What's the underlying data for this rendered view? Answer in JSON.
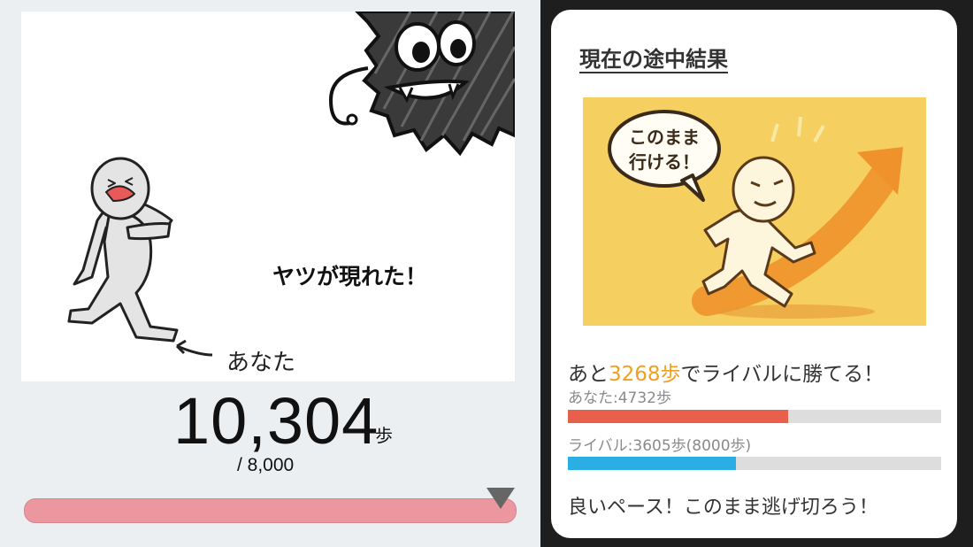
{
  "left": {
    "illustration": {
      "headline": "ヤツが現れた！",
      "you_label": "あなた"
    },
    "steps": {
      "value": "10,304",
      "unit": "歩",
      "goal": "/ 8,000"
    },
    "progress": {
      "fraction": 1.0,
      "color": "#ec97a0"
    }
  },
  "card": {
    "title": "現在の途中結果",
    "image_text": [
      "このまま",
      "行ける！"
    ],
    "status_prefix": "あと",
    "status_highlight": "3268歩",
    "status_suffix": "でライバルに勝てる！",
    "you": {
      "label": "あなた:4732歩",
      "fraction": 0.59,
      "color": "#e8604c"
    },
    "rival": {
      "label": "ライバル:3605歩(8000歩)",
      "fraction": 0.45,
      "color": "#2aaee4"
    },
    "message": "良いペース！このまま逃げ切ろう！"
  }
}
